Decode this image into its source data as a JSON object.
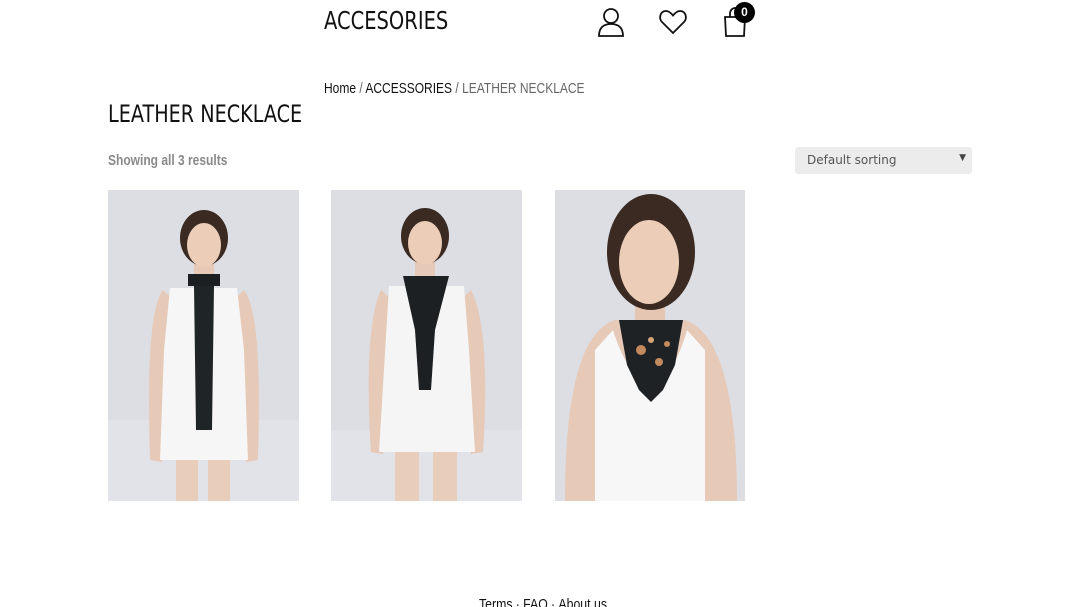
{
  "header": {
    "site_title": "ACCESORIES",
    "cart_count": "0",
    "icons": [
      "account-icon",
      "wishlist-heart-icon",
      "shopping-bag-icon"
    ]
  },
  "breadcrumb": {
    "home": "Home",
    "category": "ACCESSORIES",
    "current": "LEATHER NECKLACE",
    "separator": "/"
  },
  "page": {
    "title": "LEATHER NECKLACE",
    "result_count": "Showing all 3 results",
    "sorting_selected": "Default sorting"
  },
  "footer": {
    "links": [
      "Terms",
      "FAQ",
      "About us"
    ],
    "separator": "·"
  },
  "colors": {
    "text": "#111111",
    "muted": "#8a8a8a",
    "select_bg": "#ececec",
    "photo_bg": "#dcdee4"
  }
}
